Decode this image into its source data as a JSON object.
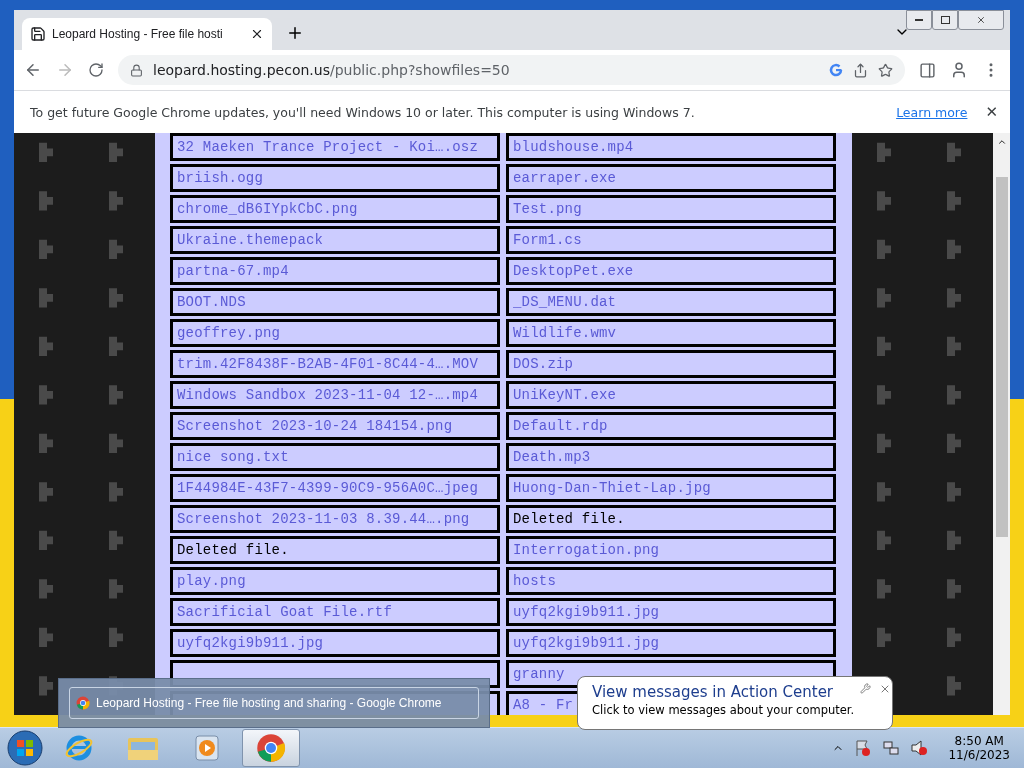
{
  "tab": {
    "title": "Leopard Hosting - Free file hosti",
    "selected": true
  },
  "address": {
    "host": "leopard.hosting.pecon.us",
    "path": "/public.php?showfiles=50"
  },
  "infobar": {
    "message": "To get future Google Chrome updates, you'll need Windows 10 or later. This computer is using Windows 7.",
    "link": "Learn more",
    "close": "✕"
  },
  "files": [
    {
      "left": {
        "kind": "file",
        "name": "32 Maeken Trance Project - Koi….osz"
      },
      "right": {
        "kind": "file",
        "name": "bludshouse.mp4"
      }
    },
    {
      "left": {
        "kind": "file",
        "name": "briish.ogg"
      },
      "right": {
        "kind": "file",
        "name": "earraper.exe"
      }
    },
    {
      "left": {
        "kind": "file",
        "name": "chrome_dB6IYpkCbC.png"
      },
      "right": {
        "kind": "file",
        "name": "Test.png"
      }
    },
    {
      "left": {
        "kind": "file",
        "name": "Ukraine.themepack"
      },
      "right": {
        "kind": "file",
        "name": "Form1.cs"
      }
    },
    {
      "left": {
        "kind": "file",
        "name": "partna-67.mp4"
      },
      "right": {
        "kind": "file",
        "name": "DesktopPet.exe"
      }
    },
    {
      "left": {
        "kind": "file",
        "name": "BOOT.NDS"
      },
      "right": {
        "kind": "file",
        "name": "_DS_MENU.dat"
      }
    },
    {
      "left": {
        "kind": "file",
        "name": "geoffrey.png"
      },
      "right": {
        "kind": "file",
        "name": "Wildlife.wmv"
      }
    },
    {
      "left": {
        "kind": "file",
        "name": "trim.42F8438F-B2AB-4F01-8C44-4….MOV"
      },
      "right": {
        "kind": "file",
        "name": "DOS.zip"
      }
    },
    {
      "left": {
        "kind": "file",
        "name": "Windows Sandbox 2023-11-04 12-….mp4"
      },
      "right": {
        "kind": "file",
        "name": "UniKeyNT.exe"
      }
    },
    {
      "left": {
        "kind": "file",
        "name": "Screenshot 2023-10-24 184154.png"
      },
      "right": {
        "kind": "file",
        "name": "Default.rdp"
      }
    },
    {
      "left": {
        "kind": "file",
        "name": "nice song.txt"
      },
      "right": {
        "kind": "file",
        "name": "Death.mp3"
      }
    },
    {
      "left": {
        "kind": "file",
        "name": "1F44984E-43F7-4399-90C9-956A0C…jpeg"
      },
      "right": {
        "kind": "file",
        "name": "Huong-Dan-Thiet-Lap.jpg"
      }
    },
    {
      "left": {
        "kind": "file",
        "name": "Screenshot 2023-11-03 8.39.44….png"
      },
      "right": {
        "kind": "deleted",
        "name": "Deleted file."
      }
    },
    {
      "left": {
        "kind": "deleted",
        "name": "Deleted file."
      },
      "right": {
        "kind": "file",
        "name": "Interrogation.png"
      }
    },
    {
      "left": {
        "kind": "file",
        "name": "play.png"
      },
      "right": {
        "kind": "file",
        "name": "hosts"
      }
    },
    {
      "left": {
        "kind": "file",
        "name": "Sacrificial Goat File.rtf"
      },
      "right": {
        "kind": "file",
        "name": "uyfq2kgi9b911.jpg"
      }
    },
    {
      "left": {
        "kind": "file",
        "name": "uyfq2kgi9b911.jpg"
      },
      "right": {
        "kind": "file",
        "name": "uyfq2kgi9b911.jpg"
      }
    },
    {
      "left": {
        "kind": "hidden"
      },
      "right": {
        "kind": "file",
        "name": "granny"
      }
    },
    {
      "left": {
        "kind": "hidden"
      },
      "right": {
        "kind": "file",
        "name": "A8 - Fr"
      }
    }
  ],
  "preview": {
    "title": "Leopard Hosting - Free file hosting and sharing - Google Chrome"
  },
  "notification": {
    "title": "View messages in Action Center",
    "body": "Click to view messages about your computer."
  },
  "taskbar": {
    "apps": [
      {
        "kind": "ie",
        "selected": false
      },
      {
        "kind": "explorer",
        "selected": false
      },
      {
        "kind": "media",
        "selected": false
      },
      {
        "kind": "chrome",
        "selected": true
      }
    ]
  },
  "clock": {
    "time": "8:50 AM",
    "date": "11/6/2023"
  }
}
